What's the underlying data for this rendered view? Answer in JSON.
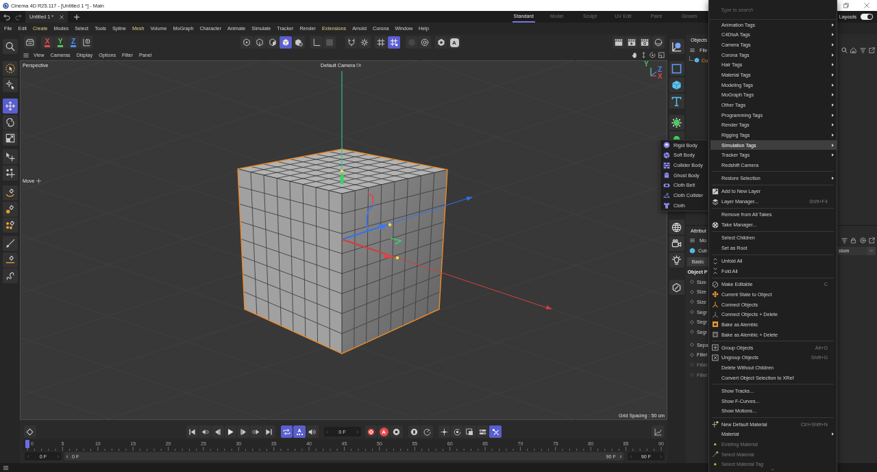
{
  "window": {
    "title": "Cinema 4D R25.117 - [Untitled 1 *] - Main"
  },
  "doc_tabs": [
    {
      "label": "Untitled 1 *",
      "selected": true
    }
  ],
  "layout_tabs": [
    {
      "label": "Standard",
      "selected": true
    },
    {
      "label": "Model",
      "selected": false
    },
    {
      "label": "Sculpt",
      "selected": false
    },
    {
      "label": "UV Edit",
      "selected": false
    },
    {
      "label": "Paint",
      "selected": false
    },
    {
      "label": "Groom",
      "selected": false
    }
  ],
  "layouts": {
    "label": "Layouts",
    "on": true
  },
  "menu_bar": [
    {
      "label": "File",
      "highlighted": false
    },
    {
      "label": "Edit",
      "highlighted": false
    },
    {
      "label": "Create",
      "highlighted": true
    },
    {
      "label": "Modes",
      "highlighted": false
    },
    {
      "label": "Select",
      "highlighted": false
    },
    {
      "label": "Tools",
      "highlighted": false
    },
    {
      "label": "Spline",
      "highlighted": false
    },
    {
      "label": "Mesh",
      "highlighted": true
    },
    {
      "label": "Volume",
      "highlighted": false
    },
    {
      "label": "MoGraph",
      "highlighted": false
    },
    {
      "label": "Character",
      "highlighted": false
    },
    {
      "label": "Animate",
      "highlighted": false
    },
    {
      "label": "Simulate",
      "highlighted": false
    },
    {
      "label": "Tracker",
      "highlighted": false
    },
    {
      "label": "Render",
      "highlighted": false
    },
    {
      "label": "Extensions",
      "highlighted": true
    },
    {
      "label": "Arnold",
      "highlighted": false
    },
    {
      "label": "Corona",
      "highlighted": false
    },
    {
      "label": "Window",
      "highlighted": false
    },
    {
      "label": "Help",
      "highlighted": false
    }
  ],
  "toolbar": {
    "left": [
      [
        {
          "on": false
        }
      ],
      [
        {
          "label": "X",
          "color": "#e14b4b",
          "on": false
        },
        {
          "label": "Y",
          "color": "#5bc35d",
          "on": false
        },
        {
          "label": "Z",
          "color": "#4a8ef0",
          "on": false
        },
        {
          "on": false
        }
      ],
      [
        {
          "on": false
        },
        {
          "on": false
        },
        {
          "on": false
        },
        {
          "on": true
        },
        {
          "on": false
        }
      ],
      [
        {
          "on": false
        },
        {
          "on": false
        }
      ],
      [
        {
          "on": false
        },
        {
          "on": false
        }
      ],
      [
        {
          "on": false
        },
        {
          "on": true
        }
      ],
      [
        {
          "on": false
        },
        {
          "on": false
        }
      ],
      [
        {
          "on": false
        },
        {
          "label": "A",
          "on": false
        }
      ]
    ],
    "right": [
      [
        {
          "on": false
        },
        {
          "on": false
        },
        {
          "on": false
        }
      ],
      [
        {
          "on": false
        }
      ]
    ]
  },
  "tools": [
    [
      {
        "selected": false
      },
      {
        "selected": false
      }
    ],
    [
      {
        "selected": true
      },
      {
        "selected": false
      },
      {
        "selected": false
      }
    ],
    [
      {
        "selected": false
      },
      {
        "selected": false
      }
    ],
    [
      {
        "selected": false
      },
      {
        "selected": false
      },
      {
        "selected": false
      }
    ],
    [
      {
        "selected": false
      },
      {
        "selected": false
      },
      {
        "selected": false
      }
    ]
  ],
  "viewport": {
    "menu": [
      "View",
      "Cameras",
      "Display",
      "Options",
      "Filter",
      "Panel"
    ],
    "view_name": "Perspective",
    "camera": "Default Camera",
    "axis_labels": [
      {
        "label": "Y",
        "color": "#45c46a"
      },
      {
        "label": "Z",
        "color": "#4e7ef5"
      },
      {
        "label": "X",
        "color": "#e04545"
      }
    ],
    "cube": {
      "selected": true
    },
    "tool": "Move",
    "grid_spacing": "Grid Spacing : 50 cm"
  },
  "palette": [
    [
      {
        "on": false
      }
    ],
    [
      {
        "on": false
      },
      {
        "on": false
      },
      {
        "on": false
      }
    ],
    [
      {
        "on": false
      },
      {
        "on": false
      }
    ],
    [
      {
        "on": false
      },
      {
        "on": false
      },
      {
        "on": false
      }
    ],
    [
      {
        "on": false
      }
    ]
  ],
  "transport": {
    "left": [
      [
        {
          "on": false
        }
      ],
      [
        {
          "on": false
        },
        {
          "on": false
        },
        {
          "on": false
        },
        {
          "on": false
        },
        {
          "on": false
        },
        {
          "on": false
        },
        {
          "on": false
        }
      ],
      [
        {
          "on": true
        },
        {
          "label": "A",
          "on": true
        },
        {
          "on": false
        }
      ]
    ],
    "frame": "0 F",
    "right": [
      [
        {
          "on": false
        },
        {
          "label": "A",
          "on": false
        },
        {
          "on": false
        }
      ],
      [
        {
          "on": false
        },
        {
          "on": false
        }
      ],
      [
        {
          "on": false
        },
        {
          "on": false
        },
        {
          "on": false
        },
        {
          "on": false
        },
        {
          "on": true
        }
      ]
    ],
    "end": [
      [
        {
          "on": false
        }
      ]
    ]
  },
  "timeline": {
    "ruler": [
      "0",
      "5",
      "10",
      "15",
      "20",
      "25",
      "30",
      "35",
      "40",
      "45",
      "50",
      "55",
      "60",
      "65",
      "70",
      "75",
      "80",
      "85",
      "90"
    ],
    "playhead": {
      "level": 0
    },
    "start": "0 F",
    "range": {
      "level": 1
    },
    "range_start": "0 F",
    "range_end": "90 F",
    "end": "90 F"
  },
  "objects_panel": {
    "tab": "Objects",
    "menu": [
      "File"
    ],
    "items": [
      {
        "name": "Cu",
        "selected": true
      }
    ]
  },
  "attributes_panel": {
    "tab": "Attribut",
    "menu": [
      "Mo"
    ],
    "object": "Cub",
    "mode": "stom",
    "tabs": [
      {
        "label": "Basic",
        "selected": false
      }
    ],
    "section": "Object P",
    "params": [
      [
        {
          "label": "Size",
          "disabled": false
        },
        {
          "label": "Size",
          "disabled": false
        },
        {
          "label": "Size",
          "disabled": false
        },
        {
          "label": "Segr",
          "disabled": false
        },
        {
          "label": "Segr",
          "disabled": false
        },
        {
          "label": "Segr",
          "disabled": false
        }
      ],
      [
        {
          "label": "Sepa",
          "disabled": false
        },
        {
          "label": "Fillet",
          "disabled": false
        },
        {
          "label": "Fillet",
          "disabled": true
        },
        {
          "label": "Fillet",
          "disabled": true
        }
      ]
    ]
  },
  "context_menu": {
    "search": {
      "placeholder": "Type to search"
    },
    "groups": [
      [
        {
          "label": "Animation Tags",
          "submenu": true,
          "disabled": false,
          "selected": false
        },
        {
          "label": "C4DtoA Tags",
          "submenu": true,
          "disabled": false,
          "selected": false
        },
        {
          "label": "Camera Tags",
          "submenu": true,
          "disabled": false,
          "selected": false
        },
        {
          "label": "Corona Tags",
          "submenu": true,
          "disabled": false,
          "selected": false
        },
        {
          "label": "Hair Tags",
          "submenu": true,
          "disabled": false,
          "selected": false
        },
        {
          "label": "Material Tags",
          "submenu": true,
          "disabled": false,
          "selected": false
        },
        {
          "label": "Modeling Tags",
          "submenu": true,
          "disabled": false,
          "selected": false
        },
        {
          "label": "MoGraph Tags",
          "submenu": true,
          "disabled": false,
          "selected": false
        },
        {
          "label": "Other Tags",
          "submenu": true,
          "disabled": false,
          "selected": false
        },
        {
          "label": "Programming Tags",
          "submenu": true,
          "disabled": false,
          "selected": false
        },
        {
          "label": "Render Tags",
          "submenu": true,
          "disabled": false,
          "selected": false
        },
        {
          "label": "Rigging Tags",
          "submenu": true,
          "disabled": false,
          "selected": false
        },
        {
          "label": "Simulation Tags",
          "submenu": true,
          "disabled": false,
          "selected": true
        },
        {
          "label": "Tracker Tags",
          "submenu": true,
          "disabled": false,
          "selected": false
        },
        {
          "label": "Redshift Camera",
          "submenu": false,
          "disabled": false,
          "selected": false
        }
      ],
      [
        {
          "label": "Restore Selection",
          "submenu": true,
          "disabled": false,
          "selected": false
        }
      ],
      [
        {
          "label": "Add to New Layer",
          "submenu": false,
          "disabled": false,
          "selected": false
        },
        {
          "label": "Layer Manager...",
          "shortcut": "Shift+F4",
          "submenu": false,
          "disabled": false,
          "selected": false
        }
      ],
      [
        {
          "label": "Remove from All Takes",
          "submenu": false,
          "disabled": false,
          "selected": false
        },
        {
          "label": "Take Manager...",
          "submenu": false,
          "disabled": false,
          "selected": false
        }
      ],
      [
        {
          "label": "Select Children",
          "submenu": false,
          "disabled": false,
          "selected": false
        },
        {
          "label": "Set as Root",
          "submenu": false,
          "disabled": false,
          "selected": false
        }
      ],
      [
        {
          "label": "Unfold All",
          "submenu": false,
          "disabled": false,
          "selected": false
        },
        {
          "label": "Fold All",
          "submenu": false,
          "disabled": false,
          "selected": false
        }
      ],
      [
        {
          "label": "Make Editable",
          "shortcut": "C",
          "submenu": false,
          "disabled": false,
          "selected": false
        },
        {
          "label": "Current State to Object",
          "submenu": false,
          "disabled": false,
          "selected": false
        },
        {
          "label": "Connect Objects",
          "submenu": false,
          "disabled": false,
          "selected": false
        },
        {
          "label": "Connect Objects + Delete",
          "submenu": false,
          "disabled": false,
          "selected": false
        },
        {
          "label": "Bake as Alembic",
          "submenu": false,
          "disabled": false,
          "selected": false
        },
        {
          "label": "Bake as Alembic + Delete",
          "submenu": false,
          "disabled": false,
          "selected": false
        }
      ],
      [
        {
          "label": "Group Objects",
          "shortcut": "Alt+G",
          "submenu": false,
          "disabled": false,
          "selected": false
        },
        {
          "label": "Ungroup Objects",
          "shortcut": "Shift+G",
          "submenu": false,
          "disabled": false,
          "selected": false
        },
        {
          "label": "Delete Without Children",
          "submenu": false,
          "disabled": false,
          "selected": false
        },
        {
          "label": "Convert Object Selection to XRef",
          "submenu": false,
          "disabled": false,
          "selected": false
        }
      ],
      [
        {
          "label": "Show Tracks...",
          "submenu": false,
          "disabled": false,
          "selected": false
        },
        {
          "label": "Show F-Curves...",
          "submenu": false,
          "disabled": false,
          "selected": false
        },
        {
          "label": "Show Motions...",
          "submenu": false,
          "disabled": false,
          "selected": false
        }
      ],
      [
        {
          "label": "New Default Material",
          "shortcut": "Ctrl+Shift+N",
          "submenu": false,
          "disabled": false,
          "selected": false
        },
        {
          "label": "Material",
          "submenu": true,
          "disabled": false,
          "selected": false
        },
        {
          "label": "Existing Material",
          "submenu": false,
          "disabled": true,
          "selected": false
        },
        {
          "label": "Select Material",
          "submenu": false,
          "disabled": true,
          "selected": false
        },
        {
          "label": "Select Material Tag",
          "submenu": false,
          "disabled": true,
          "selected": false
        }
      ]
    ]
  },
  "simulation_submenu": [
    {
      "label": "Rigid Body",
      "selected": false
    },
    {
      "label": "Soft Body",
      "selected": false
    },
    {
      "label": "Collider Body",
      "selected": false
    },
    {
      "label": "Ghost Body",
      "selected": false
    },
    {
      "label": "Cloth Belt",
      "selected": false
    },
    {
      "label": "Cloth Collider",
      "selected": false
    },
    {
      "label": "Cloth",
      "selected": false
    }
  ]
}
